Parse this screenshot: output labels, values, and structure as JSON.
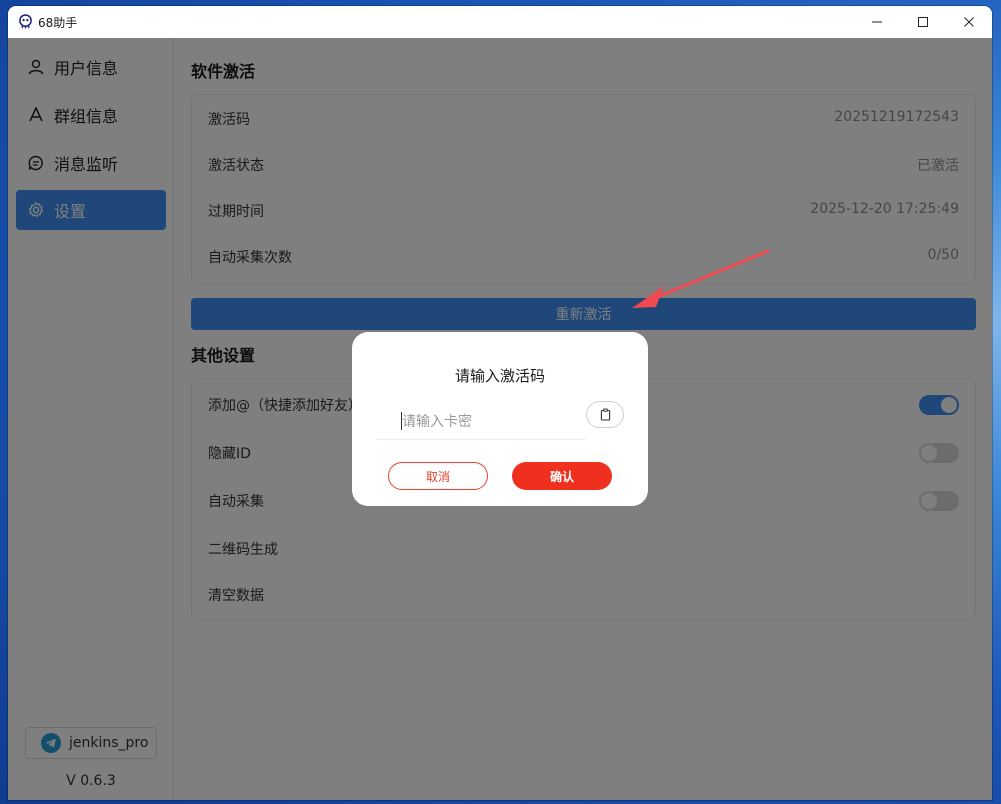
{
  "window": {
    "title": "68助手"
  },
  "sidebar": {
    "items": [
      {
        "label": "用户信息",
        "icon": "user-icon",
        "active": false
      },
      {
        "label": "群组信息",
        "icon": "group-icon",
        "active": false
      },
      {
        "label": "消息监听",
        "icon": "message-icon",
        "active": false
      },
      {
        "label": "设置",
        "icon": "gear-icon",
        "active": true
      }
    ],
    "telegram_user": "jenkins_pro",
    "version": "V 0.6.3"
  },
  "activation": {
    "title": "软件激活",
    "rows": [
      {
        "label": "激活码",
        "value": "20251219172543"
      },
      {
        "label": "激活状态",
        "value": "已激活"
      },
      {
        "label": "过期时间",
        "value": "2025-12-20 17:25:49"
      },
      {
        "label": "自动采集次数",
        "value": "0/50"
      }
    ],
    "button": "重新激活"
  },
  "other": {
    "title": "其他设置",
    "rows": [
      {
        "label": "添加@（快捷添加好友）",
        "toggle": true
      },
      {
        "label": "隐藏ID",
        "toggle": false
      },
      {
        "label": "自动采集",
        "toggle": false
      },
      {
        "label": "二维码生成"
      },
      {
        "label": "清空数据"
      }
    ]
  },
  "dialog": {
    "title": "请输入激活码",
    "placeholder": "请输入卡密",
    "value": "",
    "cancel": "取消",
    "confirm": "确认"
  },
  "colors": {
    "accent": "#3f8ff5",
    "danger": "#f0301e",
    "annotation_arrow": "#f04a50"
  }
}
